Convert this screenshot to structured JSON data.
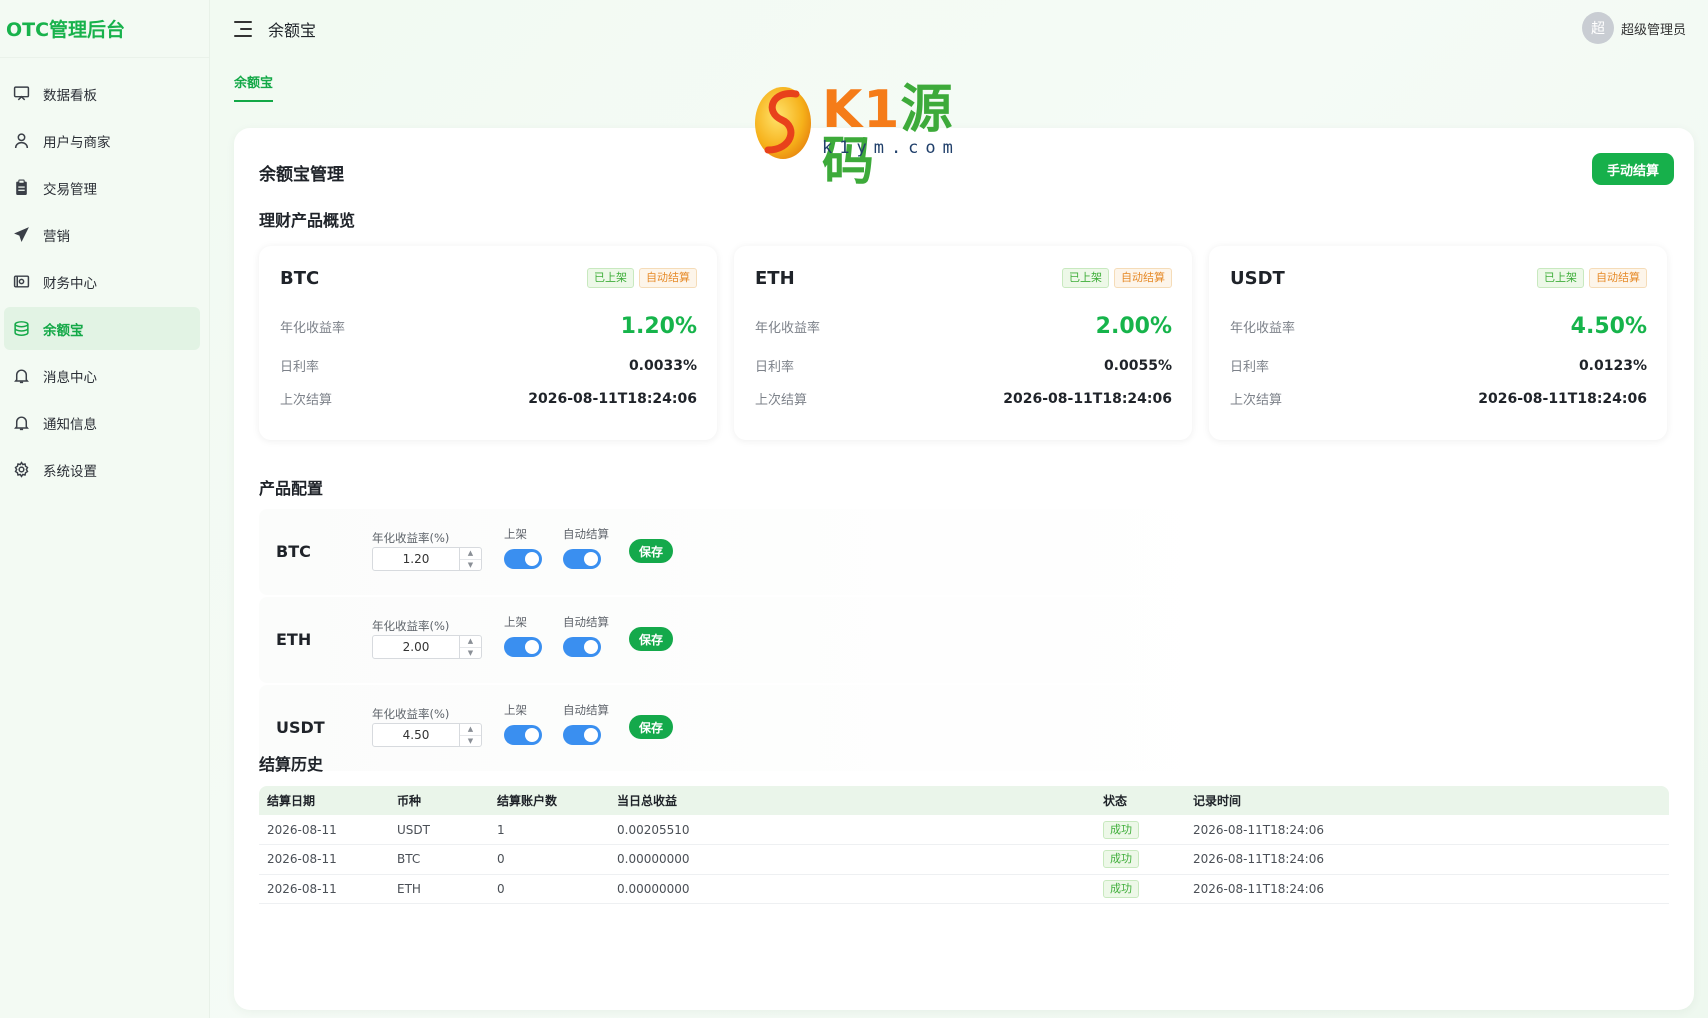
{
  "app": {
    "brand": "OTC管理后台"
  },
  "sidebar": {
    "items": [
      {
        "label": "数据看板",
        "icon": "dashboard-icon"
      },
      {
        "label": "用户与商家",
        "icon": "user-icon"
      },
      {
        "label": "交易管理",
        "icon": "clipboard-icon"
      },
      {
        "label": "营销",
        "icon": "send-icon"
      },
      {
        "label": "财务中心",
        "icon": "finance-icon"
      },
      {
        "label": "余额宝",
        "icon": "coins-icon",
        "active": true
      },
      {
        "label": "消息中心",
        "icon": "bell-icon"
      },
      {
        "label": "通知信息",
        "icon": "bell-icon"
      },
      {
        "label": "系统设置",
        "icon": "gear-icon"
      }
    ]
  },
  "header": {
    "title": "余额宝",
    "user": {
      "avatar": "超",
      "name": "超级管理员"
    }
  },
  "tabs": [
    {
      "label": "余额宝"
    }
  ],
  "watermark": {
    "text_a": "K1",
    "text_b": "源码",
    "url": "k1ym.com"
  },
  "main": {
    "title": "余额宝管理",
    "manual_settle_label": "手动结算",
    "overview_title": "理财产品概览",
    "config_title": "产品配置",
    "history_title": "结算历史",
    "overview_labels": {
      "annual": "年化收益率",
      "daily": "日利率",
      "last": "上次结算"
    },
    "products": [
      {
        "name": "BTC",
        "tag_listed": "已上架",
        "tag_auto": "自动结算",
        "annual": "1.20%",
        "daily": "0.0033%",
        "last": "2026-08-11T18:24:06"
      },
      {
        "name": "ETH",
        "tag_listed": "已上架",
        "tag_auto": "自动结算",
        "annual": "2.00%",
        "daily": "0.0055%",
        "last": "2026-08-11T18:24:06"
      },
      {
        "name": "USDT",
        "tag_listed": "已上架",
        "tag_auto": "自动结算",
        "annual": "4.50%",
        "daily": "0.0123%",
        "last": "2026-08-11T18:24:06"
      }
    ],
    "config_labels": {
      "rate": "年化收益率(%)",
      "listed": "上架",
      "auto": "自动结算",
      "save": "保存"
    },
    "configs": [
      {
        "coin": "BTC",
        "rate": "1.20",
        "listed": true,
        "auto": true
      },
      {
        "coin": "ETH",
        "rate": "2.00",
        "listed": true,
        "auto": true
      },
      {
        "coin": "USDT",
        "rate": "4.50",
        "listed": true,
        "auto": true
      }
    ],
    "history": {
      "columns": [
        "结算日期",
        "币种",
        "结算账户数",
        "当日总收益",
        "状态",
        "记录时间"
      ],
      "rows": [
        [
          "2026-08-11",
          "USDT",
          "1",
          "0.00205510",
          "成功",
          "2026-08-11T18:24:06"
        ],
        [
          "2026-08-11",
          "BTC",
          "0",
          "0.00000000",
          "成功",
          "2026-08-11T18:24:06"
        ],
        [
          "2026-08-11",
          "ETH",
          "0",
          "0.00000000",
          "成功",
          "2026-08-11T18:24:06"
        ]
      ]
    }
  },
  "colors": {
    "accent": "#17b04b",
    "switch": "#3a8ff0",
    "tag_orange": "#e68b2a",
    "watermark_orange": "#f57c19"
  }
}
